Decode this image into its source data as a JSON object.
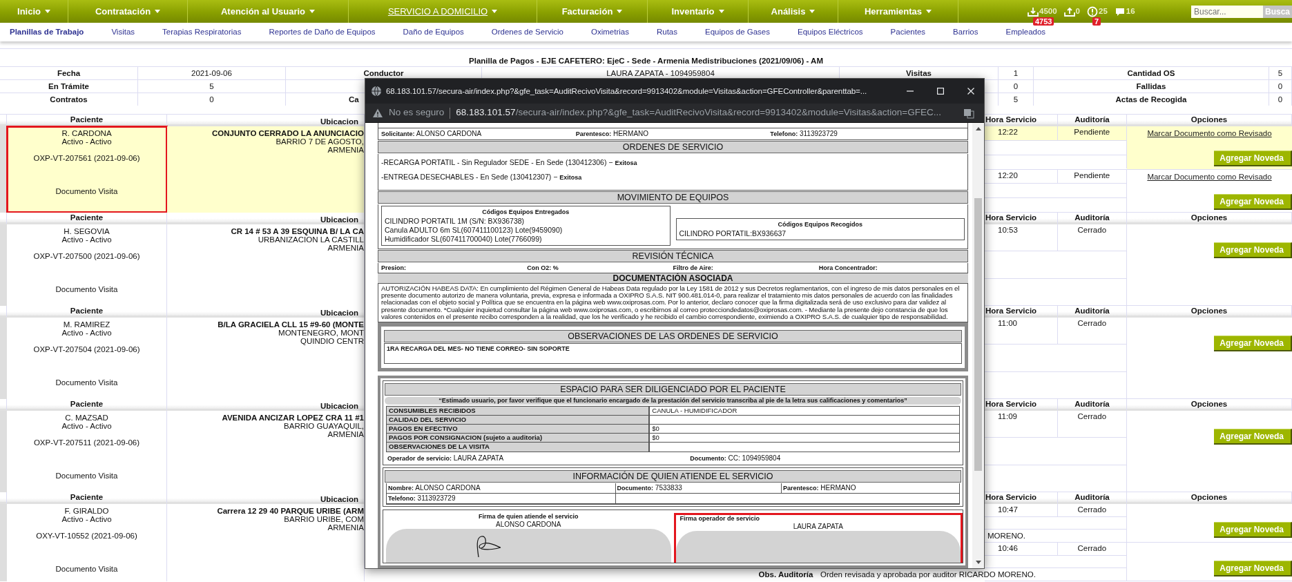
{
  "nav": {
    "items": [
      {
        "label": "Inicio",
        "selected": false
      },
      {
        "label": "Contratación",
        "selected": false
      },
      {
        "label": "Atención al Usuario",
        "selected": false
      },
      {
        "label": "SERVICIO A DOMICILIO",
        "selected": true
      },
      {
        "label": "Facturación",
        "selected": false
      },
      {
        "label": "Inventario",
        "selected": false
      },
      {
        "label": "Análisis",
        "selected": false
      },
      {
        "label": "Herramientas",
        "selected": false
      }
    ],
    "counters": [
      {
        "kind": "inbox",
        "count": "4500",
        "badge": "4753"
      },
      {
        "kind": "outbox",
        "count": "0"
      },
      {
        "kind": "alerts",
        "count": "25",
        "badge": "7"
      },
      {
        "kind": "messages",
        "count": "16"
      }
    ],
    "search": {
      "placeholder": "Buscar...",
      "button": "Busca"
    }
  },
  "subnav": [
    {
      "label": "Planillas de Trabajo",
      "selected": true
    },
    {
      "label": "Visitas",
      "selected": false
    },
    {
      "label": "Terapias Respiratorias",
      "selected": false
    },
    {
      "label": "Reportes de Daño de Equipos",
      "selected": false
    },
    {
      "label": "Daño de Equipos",
      "selected": false
    },
    {
      "label": "Ordenes de Servicio",
      "selected": false
    },
    {
      "label": "Oximetrias",
      "selected": false
    },
    {
      "label": "Rutas",
      "selected": false
    },
    {
      "label": "Equipos de Gases",
      "selected": false
    },
    {
      "label": "Equipos Eléctricos",
      "selected": false
    },
    {
      "label": "Pacientes",
      "selected": false
    },
    {
      "label": "Barrios",
      "selected": false
    },
    {
      "label": "Empleados",
      "selected": false
    }
  ],
  "summary": {
    "title": "Planilla de Pagos - EJE CAFETERO: EjeC - Sede - Armenia Medistribuciones (2021/09/06) - AM",
    "rows": [
      [
        {
          "kind": "label",
          "text": "Fecha"
        },
        {
          "kind": "value",
          "text": "2021-09-06"
        },
        {
          "kind": "label",
          "text": "Conductor"
        },
        {
          "kind": "value",
          "text": "LAURA ZAPATA - 1094959804"
        },
        {
          "kind": "label",
          "text": "Visitas"
        },
        {
          "kind": "value",
          "text": "1"
        },
        {
          "kind": "label",
          "text": "Cantidad OS"
        },
        {
          "kind": "value",
          "text": "5"
        }
      ],
      [
        {
          "kind": "label",
          "text": "En Trámite"
        },
        {
          "kind": "value",
          "text": "5"
        },
        null,
        null,
        null,
        {
          "kind": "value",
          "text": "0"
        },
        {
          "kind": "label",
          "text": "Fallidas"
        },
        {
          "kind": "value",
          "text": "0"
        }
      ],
      [
        {
          "kind": "label",
          "text": "Contratos"
        },
        {
          "kind": "value",
          "text": "0"
        },
        {
          "kind": "label",
          "text": "Ca",
          "clipped": true
        },
        null,
        null,
        {
          "kind": "value",
          "text": "5"
        },
        {
          "kind": "label",
          "text": "Actas de Recogida"
        },
        {
          "kind": "value",
          "text": "0"
        }
      ]
    ]
  },
  "blocks": [
    {
      "headers": [
        "Paciente",
        "Ubicacion",
        "Hora Servicio",
        "Auditoría",
        "Opciones"
      ],
      "highlighted": true,
      "marked": true,
      "patient": {
        "name": "R. CARDONA",
        "status": "Activo - Activo",
        "code": "OXP-VT-207561 (2021-09-06)",
        "document": "Documento Visita"
      },
      "address": [
        "CONJUNTO CERRADO LA ANUNCIACIO",
        "BARRIO 7 DE AGOSTO,",
        "ARMENIA"
      ],
      "visits": [
        {
          "time": "12:22",
          "audit": "Pendiente",
          "highlighted": true,
          "link": "Marcar Documento como Revisado",
          "button": "Agregar Noveda"
        },
        {
          "time": "12:20",
          "audit": "Pendiente",
          "highlighted": false,
          "link": "Marcar Documento como Revisado",
          "button": "Agregar Noveda"
        }
      ]
    },
    {
      "headers": [
        "Paciente",
        "Ubicacion",
        "Hora Servicio",
        "Auditoría",
        "Opciones"
      ],
      "highlighted": false,
      "marked": false,
      "patient": {
        "name": "H. SEGOVIA",
        "status": "Activo - Activo",
        "code": "OXP-VT-207500 (2021-09-06)",
        "document": "Documento Visita"
      },
      "address": [
        "CR 14 # 53 A 39 ESQUINA B/ LA CA",
        "URBANIZACION LA CASTILL",
        "ARMENIA"
      ],
      "visits": [
        {
          "time": "10:53",
          "audit": "Cerrado",
          "highlighted": false,
          "button": "Agregar Noveda"
        }
      ]
    },
    {
      "headers": [
        "Paciente",
        "Ubicacion",
        "Hora Servicio",
        "Auditoría",
        "Opciones"
      ],
      "highlighted": false,
      "marked": false,
      "patient": {
        "name": "M. RAMIREZ",
        "status": "Activo - Activo",
        "code": "OXP-VT-207504 (2021-09-06)",
        "document": "Documento Visita"
      },
      "address": [
        "B/LA GRACIELA CLL 15 #9-60 (MONTE",
        "MONTENEGRO, MONT",
        "QUINDIO CENTR"
      ],
      "visits": [
        {
          "time": "11:00",
          "audit": "Cerrado",
          "highlighted": false,
          "button": "Agregar Noveda"
        }
      ]
    },
    {
      "headers": [
        "Paciente",
        "Ubicacion",
        "Hora Servicio",
        "Auditoría",
        "Opciones"
      ],
      "highlighted": false,
      "marked": false,
      "patient": {
        "name": "C. MAZSAD",
        "status": "Activo - Activo",
        "code": "OXP-VT-207511 (2021-09-06)",
        "document": "Documento Visita"
      },
      "address": [
        "AVENIDA ANCIZAR LOPEZ CRA 11 #1",
        "BARRIO GUAYAQUIL,",
        "ARMENIA"
      ],
      "visits": [
        {
          "time": "11:09",
          "audit": "Cerrado",
          "highlighted": false,
          "button": "Agregar Noveda"
        }
      ]
    },
    {
      "headers": [
        "Paciente",
        "Ubicacion",
        "Hora Servicio",
        "Auditoría",
        "Opciones"
      ],
      "highlighted": false,
      "marked": false,
      "patient": {
        "name": "F. GIRALDO",
        "status": "Activo - Activo",
        "code": "OXY-VT-10552 (2021-09-06)",
        "document": "Documento Visita"
      },
      "address": [
        "Carrera 12 29 40 PARQUE URIBE (ARM",
        "BARRIO URIBE, COM",
        "ARMENIA"
      ],
      "visits": [
        {
          "time": "10:47",
          "audit": "Cerrado",
          "highlighted": false,
          "button": "Agregar Noveda",
          "obs": {
            "text": "MORENO."
          }
        },
        {
          "time": "10:46",
          "audit": "Cerrado",
          "highlighted": false,
          "button": "Agregar Noveda",
          "obs": {
            "label": "Obs. Auditoría",
            "text": "Orden revisada y aprobada por auditor RICARDO MORENO."
          }
        }
      ]
    }
  ],
  "popup": {
    "title": "68.183.101.57/secura-air/index.php?&gfe_task=AuditRecivoVisita&record=9913402&module=Visitas&action=GFEController&parenttab=...",
    "security": "No es seguro",
    "url_host": "68.183.101.57",
    "url_path": "/secura-air/index.php?&gfe_task=AuditRecivoVisita&record=9913402&module=Visitas&action=GFEC...",
    "requester": [
      {
        "label": "Solicitante:",
        "value": "ALONSO CARDONA"
      },
      {
        "label": "Parentesco:",
        "value": "HERMANO"
      },
      {
        "label": "Telefono:",
        "value": "3113923729"
      }
    ],
    "orders": {
      "title": "ORDENES DE SERVICIO",
      "items": [
        {
          "text": "-RECARGA PORTATIL - Sin Regulador SEDE - En Sede (130412306) −",
          "status": "Exitosa"
        },
        {
          "text": "-ENTREGA DESECHABLES - En Sede (130412307) −",
          "status": "Exitosa"
        }
      ]
    },
    "equipment": {
      "title": "MOVIMIENTO DE EQUIPOS",
      "delivered": {
        "title": "Códigos Equipos Entregados",
        "lines": [
          "CILINDRO PORTATIL 1M (S/N: BX936738)",
          "Canula ADULTO 6m SL(607411100123) Lote(9459090)",
          "Humidificador SL(607411700040) Lote(7766099)"
        ]
      },
      "collected": {
        "title": "Códigos Equipos Recogidos",
        "lines": [
          "CILINDRO PORTATIL:BX936637"
        ]
      }
    },
    "review": {
      "title": "REVISIÓN TÉCNICA",
      "fields": [
        "Presion:",
        "Con O2: %",
        "Filtro de Aire:",
        "Hora Concentrador:"
      ]
    },
    "documentation": {
      "title": "DOCUMENTACIÓN ASOCIADA",
      "text": "AUTORIZACIÓN HABEAS DATA: En cumplimiento del Régimen General de Habeas Data regulado por la Ley 1581 de 2012 y sus Decretos reglamentarios, con el ingreso de mis datos personales en el presente documento autorizo de manera voluntaria, previa, expresa e informada a OXIPRO S.A.S. NIT 900.481.014-0, para realizar el tratamiento mis datos personales de acuerdo con las finalidades relacionadas con el objeto social y Política que se encuentra en la página web www.oxiprosas.com. Por lo anterior, declaro conocer que la firma digitalizada será de uso exclusivo para dar validez al presente documento. *Cualquier inquietud consultar la página web www.oxiprosas.com, o escribirnos al correo protecciondedatos@oxiprosas.com. - Mediante la presente dejo constancia de que los valores contenidos en el presente recibo corresponden a la realidad, que los he verificado y he recibido el cambio correspondiente, eximiendo a OXIPRO S.A.S. de cualquier tipo de responsabilidad."
    },
    "observations": {
      "title": "OBSERVACIONES DE LAS ORDENES DE SERVICIO",
      "text": "1RA RECARGA DEL MES- NO TIENE CORREO- SIN SOPORTE"
    },
    "patient_space": {
      "title": "ESPACIO PARA SER DILIGENCIADO POR EL PACIENTE",
      "notice": "“Estimado usuario, por favor verifique que el funcionario encargado de la prestación del servicio transcriba al pie de la letra sus calificaciones y comentarios”",
      "rows": [
        {
          "label": "CONSUMIBLES RECIBIDOS",
          "value": "CANULA - HUMIDIFICADOR"
        },
        {
          "label": "CALIDAD DEL SERVICIO"
        },
        {
          "label": "PAGOS EN EFECTIVO",
          "value": "$0"
        },
        {
          "label": "PAGOS POR CONSIGNACION (sujeto a auditoria)",
          "value": "$0"
        },
        {
          "label": "OBSERVACIONES DE LA VISITA"
        }
      ],
      "footer": [
        {
          "label": "Operador de servicio:",
          "value": "LAURA ZAPATA"
        },
        {
          "label": "Documento:",
          "value": "CC: 1094959804"
        }
      ]
    },
    "attendant": {
      "title": "INFORMACIÓN DE QUIEN ATIENDE EL SERVICIO",
      "fields": [
        {
          "label": "Nombre:",
          "value": "ALONSO CARDONA"
        },
        {
          "label": "Documento:",
          "value": "7533833"
        },
        {
          "label": "Parentesco:",
          "value": "HERMANO"
        },
        {
          "label": "Telefono:",
          "value": "3113923729"
        }
      ]
    },
    "signatures": [
      {
        "caption": "Firma de quien atiende el servicio",
        "name": "ALONSO CARDONA",
        "signed": true,
        "marked": false
      },
      {
        "caption": "Firma operador de servicio",
        "name": "LAURA ZAPATA",
        "signed": false,
        "marked": true
      }
    ]
  }
}
